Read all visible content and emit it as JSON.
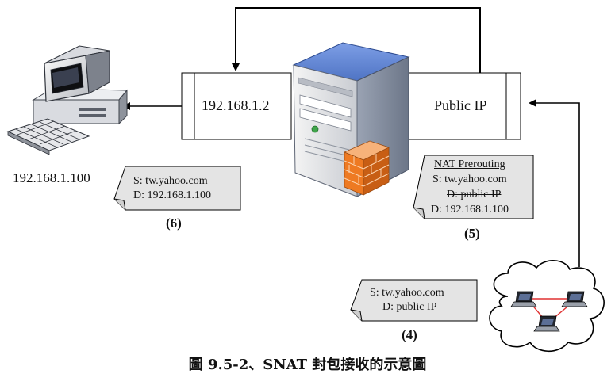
{
  "diagram": {
    "internal_host_ip": "192.168.1.100",
    "internal_interface_label": "192.168.1.2",
    "public_interface_label": "Public IP",
    "packet_6": {
      "step": "(6)",
      "source": "S: tw.yahoo.com",
      "destination": "D: 192.168.1.100"
    },
    "packet_5": {
      "step": "(5)",
      "heading": "NAT Prerouting",
      "source": "S: tw.yahoo.com",
      "destination_before": "D: public IP",
      "destination_after": "D: 192.168.1.100"
    },
    "packet_4": {
      "step": "(4)",
      "source": "S: tw.yahoo.com",
      "destination": "D: public IP"
    },
    "caption": "圖 9.5-2、SNAT 封包接收的示意圖"
  },
  "icons": [
    "desktop-computer-icon",
    "server-tower-icon",
    "firewall-icon",
    "internet-cloud-icon",
    "laptop-icon"
  ],
  "colors": {
    "note_fill": "#e4e4e4",
    "server_blue": "#4f74c4",
    "firewall_orange": "#ee7a22",
    "cloud_link_red": "#e03030"
  }
}
